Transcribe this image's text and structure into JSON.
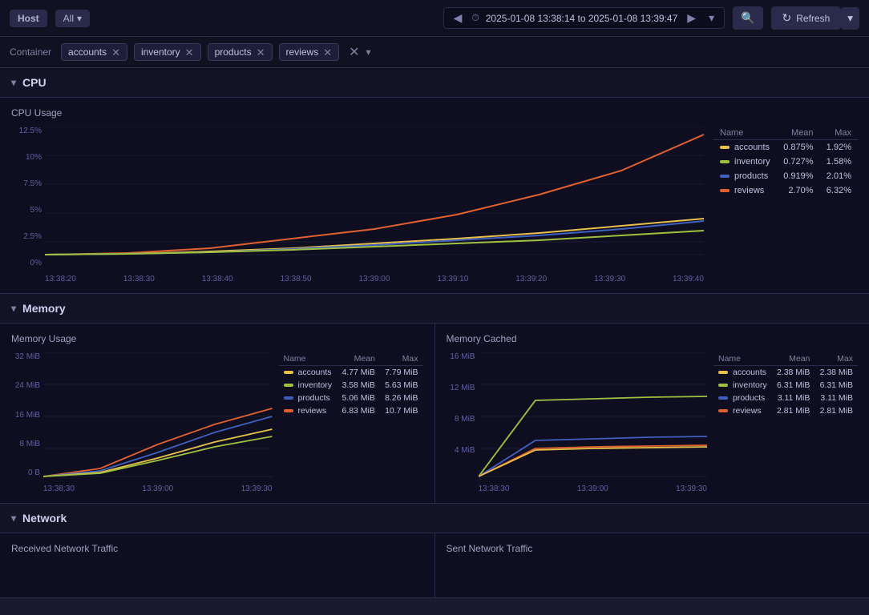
{
  "topbar": {
    "host_label": "Host",
    "all_label": "All",
    "time_range": "2025-01-08 13:38:14 to 2025-01-08 13:39:47",
    "refresh_label": "Refresh"
  },
  "filters": {
    "container_label": "Container",
    "tags": [
      "accounts",
      "inventory",
      "products",
      "reviews"
    ]
  },
  "cpu_section": {
    "title": "CPU",
    "chart_title": "CPU Usage",
    "y_labels": [
      "12.5%",
      "10%",
      "7.5%",
      "5%",
      "2.5%",
      "0%"
    ],
    "x_labels": [
      "13:38:20",
      "13:38:30",
      "13:38:40",
      "13:38:50",
      "13:39:00",
      "13:39:10",
      "13:39:20",
      "13:39:30",
      "13:39:40"
    ],
    "legend": {
      "headers": [
        "Name",
        "Mean",
        "Max"
      ],
      "rows": [
        {
          "name": "accounts",
          "color": "#e8c04a",
          "mean": "0.875%",
          "max": "1.92%"
        },
        {
          "name": "inventory",
          "color": "#a0c040",
          "mean": "0.727%",
          "max": "1.58%"
        },
        {
          "name": "products",
          "color": "#4060c0",
          "mean": "0.919%",
          "max": "2.01%"
        },
        {
          "name": "reviews",
          "color": "#e06030",
          "mean": "2.70%",
          "max": "6.32%"
        }
      ]
    }
  },
  "memory_section": {
    "title": "Memory",
    "usage_chart": {
      "title": "Memory Usage",
      "y_labels": [
        "32 MiB",
        "24 MiB",
        "16 MiB",
        "8 MiB",
        "0 B"
      ],
      "x_labels": [
        "13:38:30",
        "13:39:00",
        "13:39:30"
      ],
      "legend": {
        "headers": [
          "Name",
          "Mean",
          "Max"
        ],
        "rows": [
          {
            "name": "accounts",
            "color": "#e8c04a",
            "mean": "4.77 MiB",
            "max": "7.79 MiB"
          },
          {
            "name": "inventory",
            "color": "#a0c040",
            "mean": "3.58 MiB",
            "max": "5.63 MiB"
          },
          {
            "name": "products",
            "color": "#4060c0",
            "mean": "5.06 MiB",
            "max": "8.26 MiB"
          },
          {
            "name": "reviews",
            "color": "#e06030",
            "mean": "6.83 MiB",
            "max": "10.7 MiB"
          }
        ]
      }
    },
    "cached_chart": {
      "title": "Memory Cached",
      "y_labels": [
        "16 MiB",
        "12 MiB",
        "8 MiB",
        "4 MiB",
        ""
      ],
      "x_labels": [
        "13:38:30",
        "13:39:00",
        "13:39:30"
      ],
      "legend": {
        "headers": [
          "Name",
          "Mean",
          "Max"
        ],
        "rows": [
          {
            "name": "accounts",
            "color": "#e8c04a",
            "mean": "2.38 MiB",
            "max": "2.38 MiB"
          },
          {
            "name": "inventory",
            "color": "#a0c040",
            "mean": "6.31 MiB",
            "max": "6.31 MiB"
          },
          {
            "name": "products",
            "color": "#4060c0",
            "mean": "3.11 MiB",
            "max": "3.11 MiB"
          },
          {
            "name": "reviews",
            "color": "#e06030",
            "mean": "2.81 MiB",
            "max": "2.81 MiB"
          }
        ]
      }
    }
  },
  "network_section": {
    "title": "Network",
    "received_title": "Received Network Traffic",
    "sent_title": "Sent Network Traffic"
  },
  "icons": {
    "chevron_down": "▾",
    "chevron_left": "◀",
    "chevron_right": "▶",
    "refresh": "↻",
    "zoom_out": "🔍",
    "close": "✕"
  }
}
